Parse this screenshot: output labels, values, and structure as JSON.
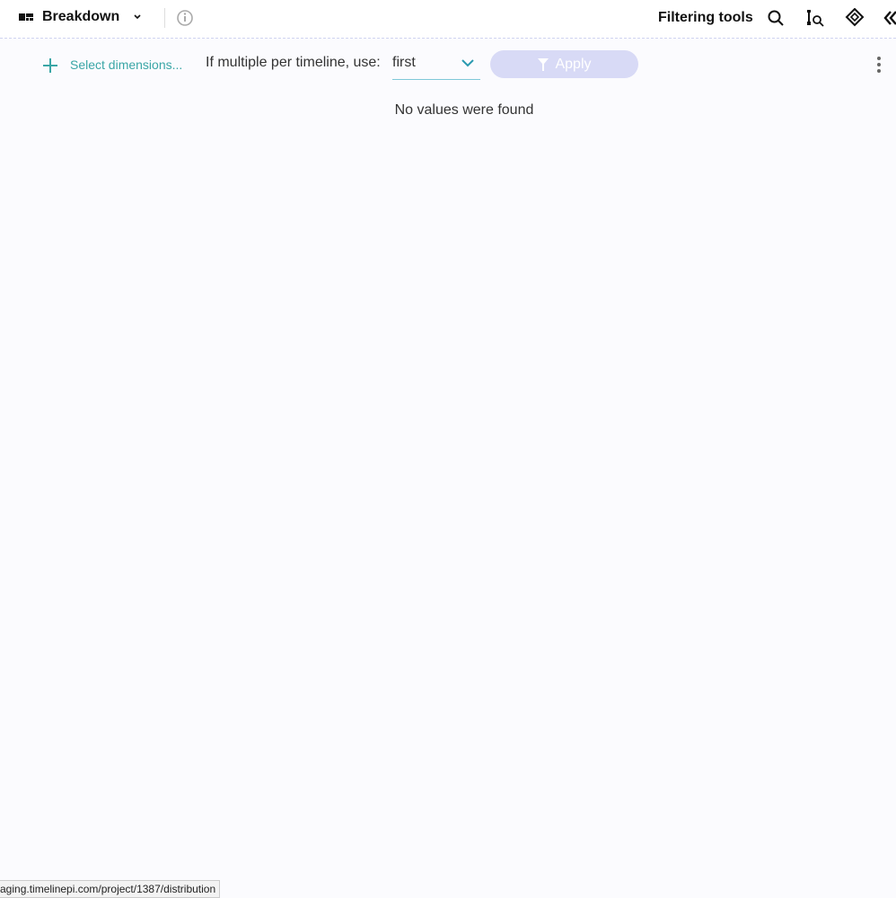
{
  "header": {
    "title": "Breakdown",
    "filtering_tools": "Filtering tools"
  },
  "toolbar": {
    "select_dimensions": "Select dimensions...",
    "multiple_label": "If multiple per timeline, use:",
    "multiple_value": "first",
    "apply": "Apply"
  },
  "main": {
    "empty_message": "No values were found"
  },
  "status_bar": {
    "url": "aging.timelinepi.com/project/1387/distribution"
  },
  "colors": {
    "accent": "#3aa6a6",
    "apply_bg": "#d8daf6"
  }
}
